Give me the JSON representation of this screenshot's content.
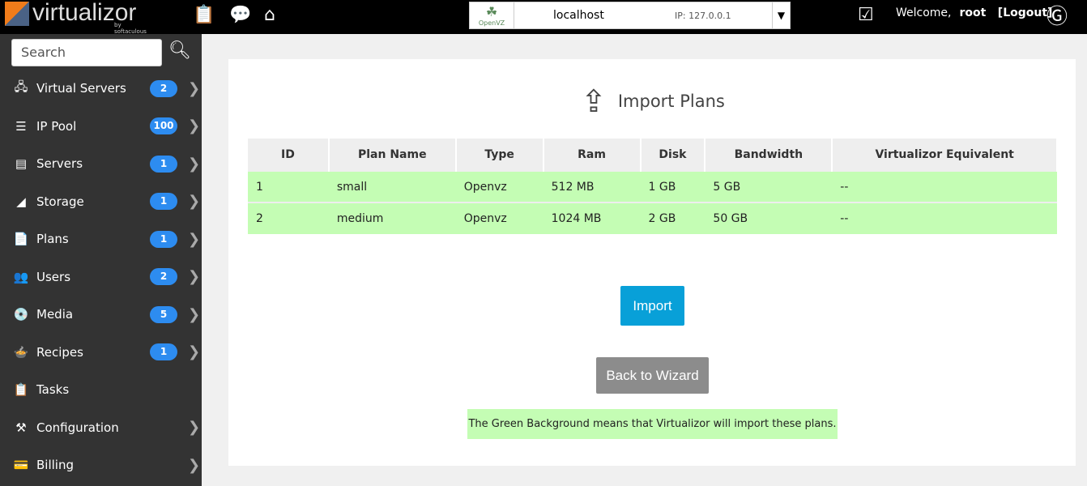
{
  "header": {
    "brand": "virtualizor",
    "brand_sub": "by softaculous",
    "server": {
      "virt": "OpenVZ",
      "host": "localhost",
      "ip": "IP: 127.0.0.1"
    },
    "welcome": "Welcome,",
    "user": "root",
    "logout": "[Logout]"
  },
  "sidebar": {
    "search_placeholder": "Search",
    "items": [
      {
        "label": "Virtual Servers",
        "badge": "2",
        "icon": "server-group-icon"
      },
      {
        "label": "IP Pool",
        "badge": "100",
        "icon": "ip-pool-icon"
      },
      {
        "label": "Servers",
        "badge": "1",
        "icon": "server-icon"
      },
      {
        "label": "Storage",
        "badge": "1",
        "icon": "storage-icon"
      },
      {
        "label": "Plans",
        "badge": "1",
        "icon": "plans-icon"
      },
      {
        "label": "Users",
        "badge": "2",
        "icon": "users-icon"
      },
      {
        "label": "Media",
        "badge": "5",
        "icon": "media-icon"
      },
      {
        "label": "Recipes",
        "badge": "1",
        "icon": "recipes-icon"
      },
      {
        "label": "Tasks",
        "badge": null,
        "icon": "tasks-icon"
      },
      {
        "label": "Configuration",
        "badge": null,
        "icon": "configuration-icon"
      },
      {
        "label": "Billing",
        "badge": null,
        "icon": "billing-icon"
      }
    ]
  },
  "main": {
    "title": "Import Plans",
    "columns": [
      "ID",
      "Plan Name",
      "Type",
      "Ram",
      "Disk",
      "Bandwidth",
      "Virtualizor Equivalent"
    ],
    "rows": [
      [
        "1",
        "small",
        "Openvz",
        "512 MB",
        "1 GB",
        "5 GB",
        "--"
      ],
      [
        "2",
        "medium",
        "Openvz",
        "1024 MB",
        "2 GB",
        "50 GB",
        "--"
      ]
    ],
    "import_label": "Import",
    "back_label": "Back to Wizard",
    "note": "The Green Background means that Virtualizor will import these plans."
  },
  "colors": {
    "row_green": "#c4fdb4",
    "badge": "#2d8cf0",
    "import": "#08a0d8"
  }
}
